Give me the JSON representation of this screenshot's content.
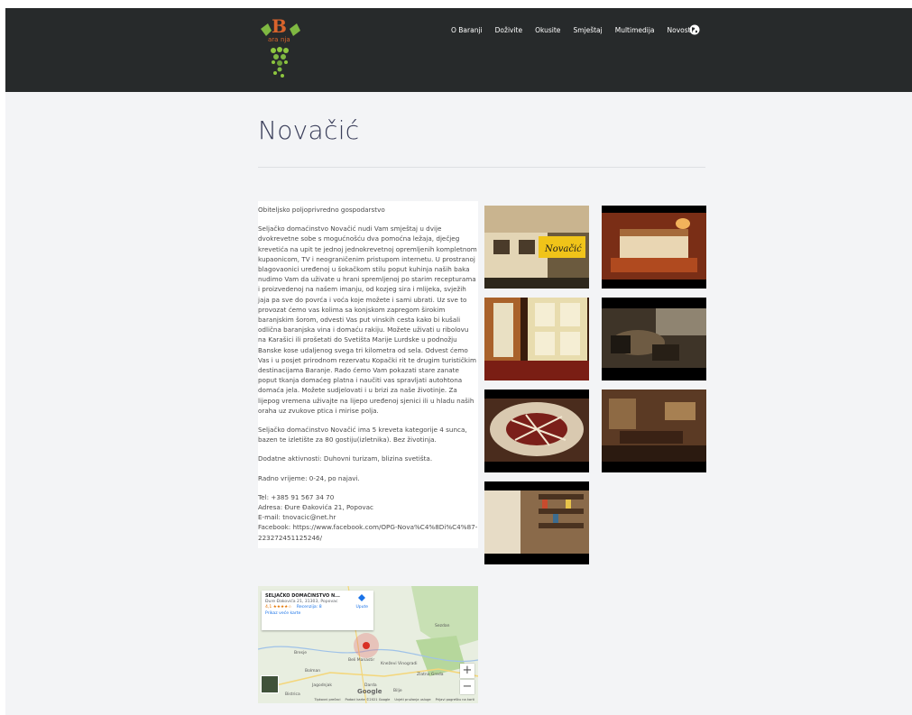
{
  "nav": {
    "items": [
      "O Baranji",
      "Doživite",
      "Okusite",
      "Smještaj",
      "Multimedija",
      "Novosti"
    ],
    "language_icon": "globe-icon"
  },
  "logo": {
    "icon": "grape-logo-icon"
  },
  "page": {
    "title": "Novačić"
  },
  "content": {
    "paragraphs": [
      "Obiteljsko poljoprivredno gospodarstvo",
      "Seljačko domaćinstvo Novačić nudi Vam smještaj u dvije dvokrevetne sobe s mogućnošću dva pomoćna ležaja, dječjeg krevetića na upit te jednoj jednokrevetnoj opremljenih kompletnom kupaonicom, TV i neograničenim pristupom internetu. U prostranoj blagovaonici uređenoj u šokačkom stilu poput kuhinja naših baka nudimo Vam da uživate u hrani spremljenoj po starim recepturama i proizvedenoj na našem imanju, od kozjeg sira i mlijeka, svježih jaja pa sve do povrća i voća koje možete i sami ubrati. Uz sve to provozat ćemo vas kolima sa konjskom zapregom širokim baranjskim šorom, odvesti Vas put vinskih cesta kako bi kušali odlična baranjska vina i domaću rakiju. Možete uživati u ribolovu na Karašici ili prošetati do Svetišta Marije Lurdske u podnožju Banske kose udaljenog svega tri kilometra od sela. Odvest ćemo Vas i u posjet prirodnom rezervatu Kopački rit te drugim turističkim destinacijama Baranje. Rado ćemo Vam pokazati stare zanate poput tkanja domaćeg platna i naučiti vas spravljati autohtona domaća jela. Možete sudjelovati i u brizi za naše životinje. Za lijepog vremena uživajte na lijepo uređenoj sjenici ili u hladu naših oraha uz zvukove ptica i mirise polja.",
      "Seljačko domaćinstvo Novačić ima 5 kreveta kategorije 4 sunca, bazen te izletište za 80 gostiju(izletnika). Bez životinja.",
      "Dodatne aktivnosti: Duhovni turizam, blizina svetišta.",
      "Radno vrijeme: 0-24, po najavi."
    ],
    "contact": {
      "tel": "Tel: +385 91 567 34 70",
      "address": "Adresa: Đure Đakovića 21, Popovac",
      "email": "E-mail: tnovacic@net.hr",
      "facebook": "Facebook: https://www.facebook.com/OPG-Nova%C4%8Di%C4%87-223272451125246/"
    }
  },
  "gallery": {
    "photos": [
      "house-sign-photo",
      "bedroom-photo",
      "door-photo",
      "dining-photo",
      "food-plate-photo",
      "restaurant-interior-photo",
      "shelf-interior-photo"
    ]
  },
  "map": {
    "place_name": "SELJAČKO DOMAĆINSTVO N...",
    "place_address": "Đure Đakovića 21, 31303, Popovac",
    "rating": "4,1 ★★★★☆",
    "reviews": "Recenzija: 8",
    "larger_map": "Prikaz veće karte",
    "directions": "Upute",
    "zoom_in": "+",
    "zoom_out": "−",
    "labels": [
      "Bolman",
      "Jagodnjak",
      "Darda",
      "Bilje",
      "Kneževi Vinogradi",
      "Zlatna Greda",
      "Bresje",
      "Beli Manastir",
      "Sezdan",
      "Bistrica"
    ],
    "footer": [
      "Tipkovni prečaci",
      "Podaci karte ©2021 Google",
      "Uvjeti pružanja usluge",
      "Prijavi pogrešku na karti"
    ],
    "google": "Google"
  }
}
